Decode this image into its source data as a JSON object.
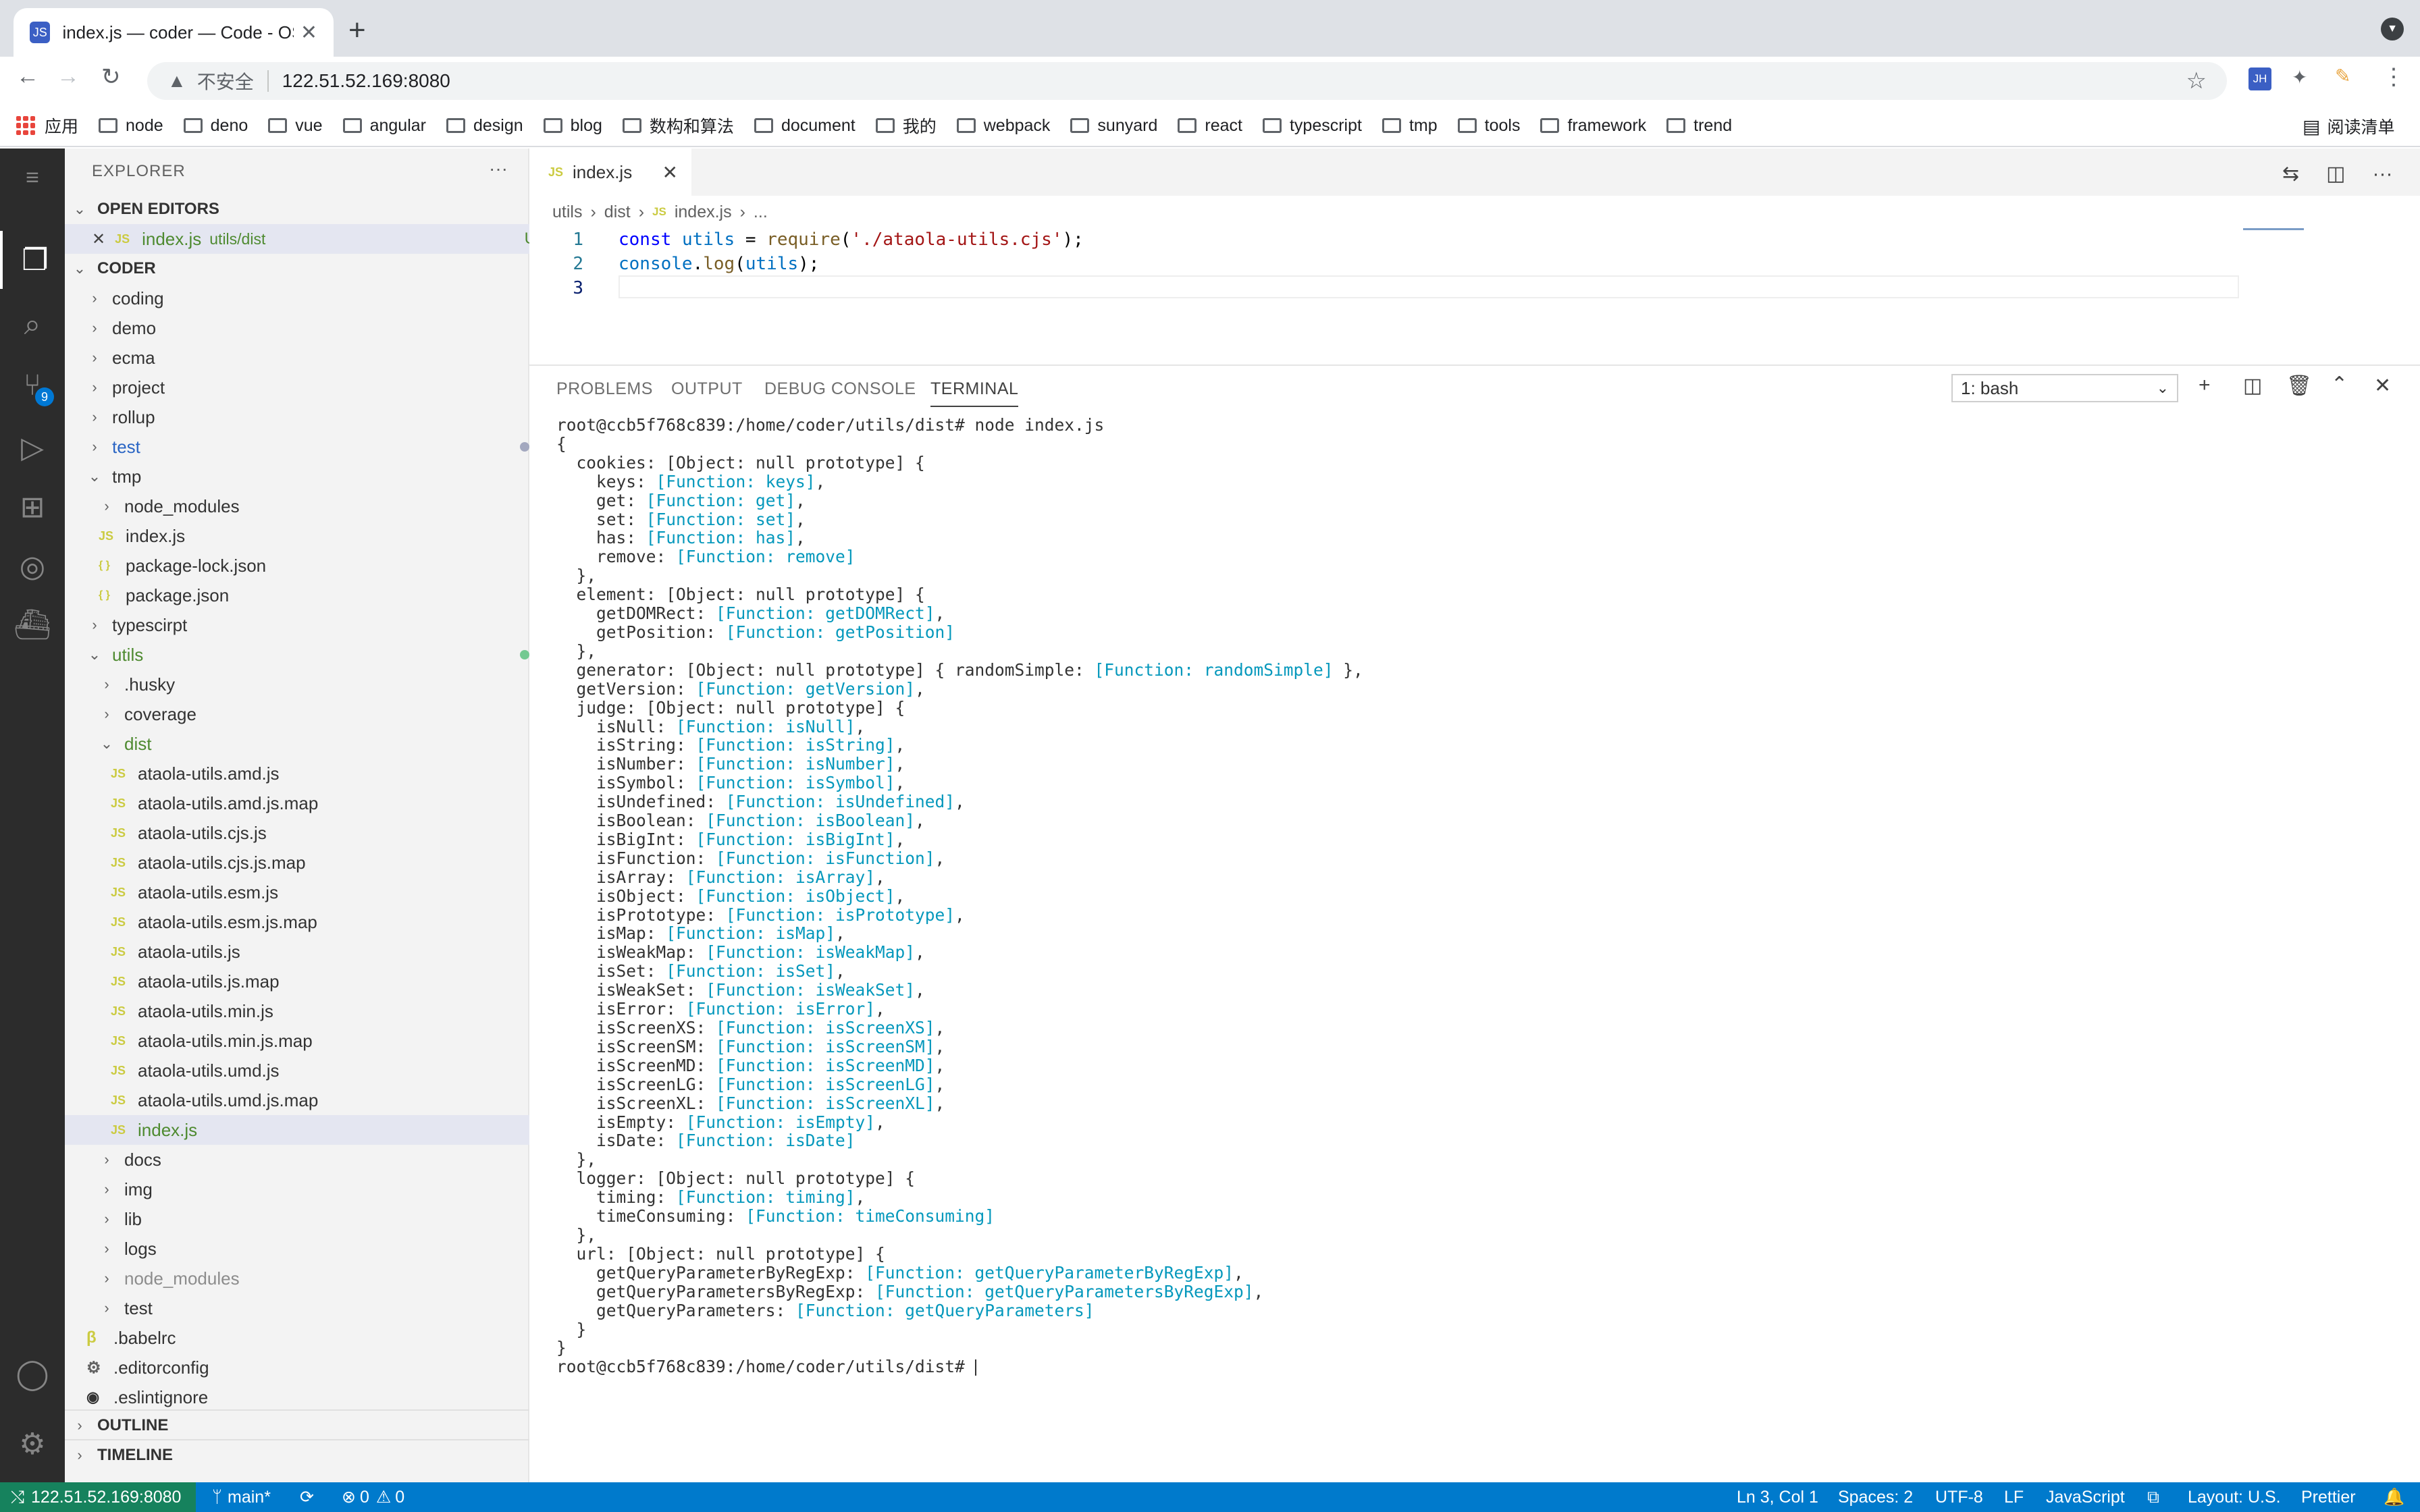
{
  "browser": {
    "tab_title": "index.js — coder — Code - OSS",
    "tab_favicon": "JS",
    "url_warning": "不安全",
    "url": "122.51.52.169:8080",
    "ext_avatar": "JH",
    "bookmarks": [
      "应用",
      "node",
      "deno",
      "vue",
      "angular",
      "design",
      "blog",
      "数构和算法",
      "document",
      "我的",
      "webpack",
      "sunyard",
      "react",
      "typescript",
      "tmp",
      "tools",
      "framework",
      "trend"
    ],
    "reading_list": "阅读清单"
  },
  "activity": {
    "scm_badge": "9"
  },
  "explorer": {
    "title": "EXPLORER",
    "open_editors_header": "OPEN EDITORS",
    "open_editor": {
      "name": "index.js",
      "path": "utils/dist",
      "status": "U"
    },
    "folder_header": "CODER",
    "tree": [
      {
        "label": "coding",
        "type": "folder"
      },
      {
        "label": "demo",
        "type": "folder"
      },
      {
        "label": "ecma",
        "type": "folder"
      },
      {
        "label": "project",
        "type": "folder"
      },
      {
        "label": "rollup",
        "type": "folder"
      },
      {
        "label": "test",
        "type": "folder"
      },
      {
        "label": "tmp",
        "type": "folder"
      },
      {
        "label": "node_modules",
        "type": "folder"
      },
      {
        "label": "index.js",
        "type": "js"
      },
      {
        "label": "package-lock.json",
        "type": "json"
      },
      {
        "label": "package.json",
        "type": "json"
      },
      {
        "label": "typescirpt",
        "type": "folder"
      },
      {
        "label": "utils",
        "type": "folder"
      },
      {
        "label": ".husky",
        "type": "folder"
      },
      {
        "label": "coverage",
        "type": "folder"
      },
      {
        "label": "dist",
        "type": "folder"
      },
      {
        "label": "ataola-utils.amd.js",
        "type": "js"
      },
      {
        "label": "ataola-utils.amd.js.map",
        "type": "js"
      },
      {
        "label": "ataola-utils.cjs.js",
        "type": "js"
      },
      {
        "label": "ataola-utils.cjs.js.map",
        "type": "js"
      },
      {
        "label": "ataola-utils.esm.js",
        "type": "js"
      },
      {
        "label": "ataola-utils.esm.js.map",
        "type": "js"
      },
      {
        "label": "ataola-utils.js",
        "type": "js"
      },
      {
        "label": "ataola-utils.js.map",
        "type": "js"
      },
      {
        "label": "ataola-utils.min.js",
        "type": "js"
      },
      {
        "label": "ataola-utils.min.js.map",
        "type": "js"
      },
      {
        "label": "ataola-utils.umd.js",
        "type": "js"
      },
      {
        "label": "ataola-utils.umd.js.map",
        "type": "js"
      },
      {
        "label": "index.js",
        "type": "js",
        "status": "U"
      },
      {
        "label": "docs",
        "type": "folder"
      },
      {
        "label": "img",
        "type": "folder"
      },
      {
        "label": "lib",
        "type": "folder"
      },
      {
        "label": "logs",
        "type": "folder"
      },
      {
        "label": "node_modules",
        "type": "folder"
      },
      {
        "label": "test",
        "type": "folder"
      },
      {
        "label": ".babelrc",
        "type": "babel"
      },
      {
        "label": ".editorconfig",
        "type": "gear"
      },
      {
        "label": ".eslintignore",
        "type": "circle"
      }
    ],
    "outline": "OUTLINE",
    "timeline": "TIMELINE"
  },
  "editor": {
    "tab": "index.js",
    "breadcrumb": [
      "utils",
      "dist",
      "index.js",
      "..."
    ],
    "lines": [
      {
        "n": "1"
      },
      {
        "n": "2"
      },
      {
        "n": "3"
      }
    ],
    "code": {
      "l1": {
        "kw": "const",
        "var": "utils",
        "eq": " = ",
        "fn": "require",
        "open": "(",
        "str": "'./ataola-utils.cjs'",
        "close": ");"
      },
      "l2": {
        "obj": "console",
        "dot": ".",
        "fn": "log",
        "open": "(",
        "var": "utils",
        "close": ");"
      }
    }
  },
  "panel": {
    "tabs": [
      "PROBLEMS",
      "OUTPUT",
      "DEBUG CONSOLE",
      "TERMINAL"
    ],
    "active_tab": "TERMINAL",
    "terminal_select": "1: bash",
    "terminal_lines": [
      [
        [
          "root@ccb5f768c839:/home/coder/utils/dist# node index.js",
          ""
        ]
      ],
      [
        [
          "{",
          ""
        ]
      ],
      [
        [
          "  cookies: [Object: null prototype] {",
          ""
        ]
      ],
      [
        [
          "    keys: ",
          ""
        ],
        [
          "[Function: keys]",
          "f"
        ],
        [
          ",",
          ""
        ]
      ],
      [
        [
          "    get: ",
          ""
        ],
        [
          "[Function: get]",
          "f"
        ],
        [
          ",",
          ""
        ]
      ],
      [
        [
          "    set: ",
          ""
        ],
        [
          "[Function: set]",
          "f"
        ],
        [
          ",",
          ""
        ]
      ],
      [
        [
          "    has: ",
          ""
        ],
        [
          "[Function: has]",
          "f"
        ],
        [
          ",",
          ""
        ]
      ],
      [
        [
          "    remove: ",
          ""
        ],
        [
          "[Function: remove]",
          "f"
        ]
      ],
      [
        [
          "  },",
          ""
        ]
      ],
      [
        [
          "  element: [Object: null prototype] {",
          ""
        ]
      ],
      [
        [
          "    getDOMRect: ",
          ""
        ],
        [
          "[Function: getDOMRect]",
          "f"
        ],
        [
          ",",
          ""
        ]
      ],
      [
        [
          "    getPosition: ",
          ""
        ],
        [
          "[Function: getPosition]",
          "f"
        ]
      ],
      [
        [
          "  },",
          ""
        ]
      ],
      [
        [
          "  generator: [Object: null prototype] { randomSimple: ",
          ""
        ],
        [
          "[Function: randomSimple]",
          "f"
        ],
        [
          " },",
          ""
        ]
      ],
      [
        [
          "  getVersion: ",
          ""
        ],
        [
          "[Function: getVersion]",
          "f"
        ],
        [
          ",",
          ""
        ]
      ],
      [
        [
          "  judge: [Object: null prototype] {",
          ""
        ]
      ],
      [
        [
          "    isNull: ",
          ""
        ],
        [
          "[Function: isNull]",
          "f"
        ],
        [
          ",",
          ""
        ]
      ],
      [
        [
          "    isString: ",
          ""
        ],
        [
          "[Function: isString]",
          "f"
        ],
        [
          ",",
          ""
        ]
      ],
      [
        [
          "    isNumber: ",
          ""
        ],
        [
          "[Function: isNumber]",
          "f"
        ],
        [
          ",",
          ""
        ]
      ],
      [
        [
          "    isSymbol: ",
          ""
        ],
        [
          "[Function: isSymbol]",
          "f"
        ],
        [
          ",",
          ""
        ]
      ],
      [
        [
          "    isUndefined: ",
          ""
        ],
        [
          "[Function: isUndefined]",
          "f"
        ],
        [
          ",",
          ""
        ]
      ],
      [
        [
          "    isBoolean: ",
          ""
        ],
        [
          "[Function: isBoolean]",
          "f"
        ],
        [
          ",",
          ""
        ]
      ],
      [
        [
          "    isBigInt: ",
          ""
        ],
        [
          "[Function: isBigInt]",
          "f"
        ],
        [
          ",",
          ""
        ]
      ],
      [
        [
          "    isFunction: ",
          ""
        ],
        [
          "[Function: isFunction]",
          "f"
        ],
        [
          ",",
          ""
        ]
      ],
      [
        [
          "    isArray: ",
          ""
        ],
        [
          "[Function: isArray]",
          "f"
        ],
        [
          ",",
          ""
        ]
      ],
      [
        [
          "    isObject: ",
          ""
        ],
        [
          "[Function: isObject]",
          "f"
        ],
        [
          ",",
          ""
        ]
      ],
      [
        [
          "    isPrototype: ",
          ""
        ],
        [
          "[Function: isPrototype]",
          "f"
        ],
        [
          ",",
          ""
        ]
      ],
      [
        [
          "    isMap: ",
          ""
        ],
        [
          "[Function: isMap]",
          "f"
        ],
        [
          ",",
          ""
        ]
      ],
      [
        [
          "    isWeakMap: ",
          ""
        ],
        [
          "[Function: isWeakMap]",
          "f"
        ],
        [
          ",",
          ""
        ]
      ],
      [
        [
          "    isSet: ",
          ""
        ],
        [
          "[Function: isSet]",
          "f"
        ],
        [
          ",",
          ""
        ]
      ],
      [
        [
          "    isWeakSet: ",
          ""
        ],
        [
          "[Function: isWeakSet]",
          "f"
        ],
        [
          ",",
          ""
        ]
      ],
      [
        [
          "    isError: ",
          ""
        ],
        [
          "[Function: isError]",
          "f"
        ],
        [
          ",",
          ""
        ]
      ],
      [
        [
          "    isScreenXS: ",
          ""
        ],
        [
          "[Function: isScreenXS]",
          "f"
        ],
        [
          ",",
          ""
        ]
      ],
      [
        [
          "    isScreenSM: ",
          ""
        ],
        [
          "[Function: isScreenSM]",
          "f"
        ],
        [
          ",",
          ""
        ]
      ],
      [
        [
          "    isScreenMD: ",
          ""
        ],
        [
          "[Function: isScreenMD]",
          "f"
        ],
        [
          ",",
          ""
        ]
      ],
      [
        [
          "    isScreenLG: ",
          ""
        ],
        [
          "[Function: isScreenLG]",
          "f"
        ],
        [
          ",",
          ""
        ]
      ],
      [
        [
          "    isScreenXL: ",
          ""
        ],
        [
          "[Function: isScreenXL]",
          "f"
        ],
        [
          ",",
          ""
        ]
      ],
      [
        [
          "    isEmpty: ",
          ""
        ],
        [
          "[Function: isEmpty]",
          "f"
        ],
        [
          ",",
          ""
        ]
      ],
      [
        [
          "    isDate: ",
          ""
        ],
        [
          "[Function: isDate]",
          "f"
        ]
      ],
      [
        [
          "  },",
          ""
        ]
      ],
      [
        [
          "  logger: [Object: null prototype] {",
          ""
        ]
      ],
      [
        [
          "    timing: ",
          ""
        ],
        [
          "[Function: timing]",
          "f"
        ],
        [
          ",",
          ""
        ]
      ],
      [
        [
          "    timeConsuming: ",
          ""
        ],
        [
          "[Function: timeConsuming]",
          "f"
        ]
      ],
      [
        [
          "  },",
          ""
        ]
      ],
      [
        [
          "  url: [Object: null prototype] {",
          ""
        ]
      ],
      [
        [
          "    getQueryParameterByRegExp: ",
          ""
        ],
        [
          "[Function: getQueryParameterByRegExp]",
          "f"
        ],
        [
          ",",
          ""
        ]
      ],
      [
        [
          "    getQueryParametersByRegExp: ",
          ""
        ],
        [
          "[Function: getQueryParametersByRegExp]",
          "f"
        ],
        [
          ",",
          ""
        ]
      ],
      [
        [
          "    getQueryParameters: ",
          ""
        ],
        [
          "[Function: getQueryParameters]",
          "f"
        ]
      ],
      [
        [
          "  }",
          ""
        ]
      ],
      [
        [
          "}",
          ""
        ]
      ],
      [
        [
          "root@ccb5f768c839:/home/coder/utils/dist# ",
          ""
        ]
      ]
    ]
  },
  "status": {
    "remote": "122.51.52.169:8080",
    "branch": "main*",
    "errors": "0",
    "warnings": "0",
    "position": "Ln 3, Col 1",
    "spaces": "Spaces: 2",
    "encoding": "UTF-8",
    "eol": "LF",
    "language": "JavaScript",
    "layout": "Layout: U.S.",
    "formatter": "Prettier"
  }
}
